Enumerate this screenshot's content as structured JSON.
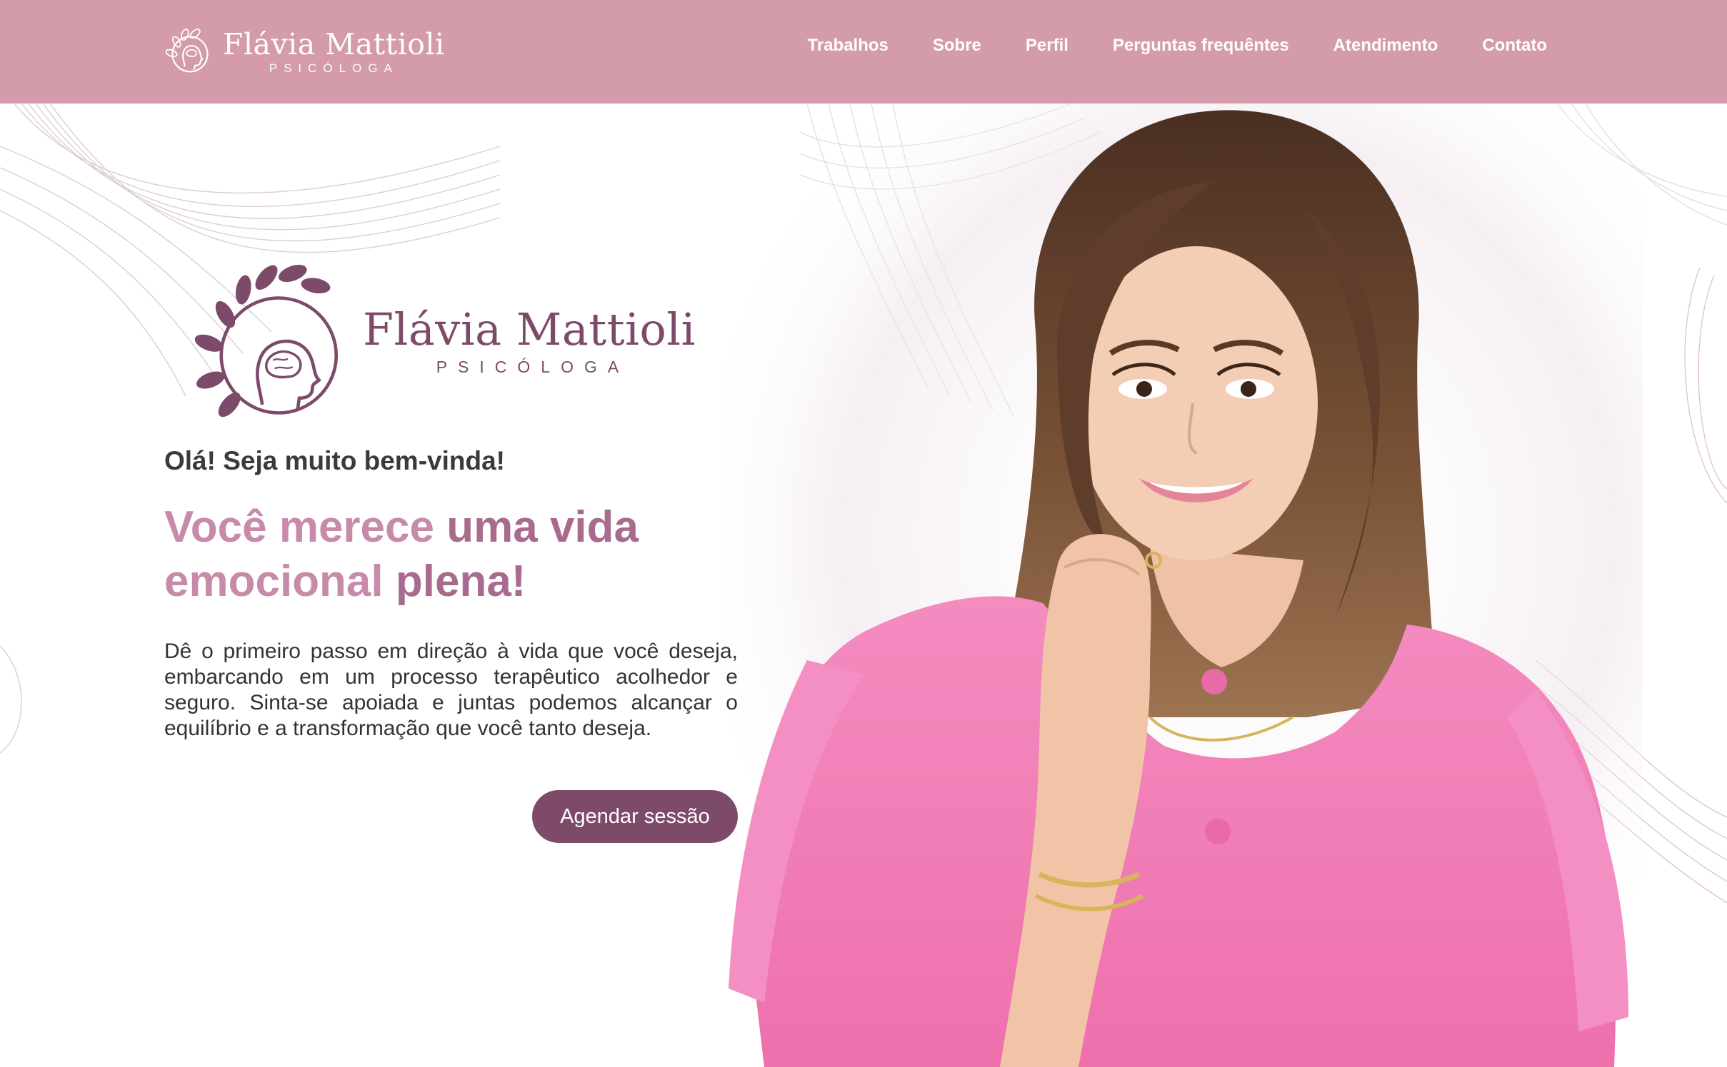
{
  "header": {
    "brand_name": "Flávia Mattioli",
    "brand_sub": "PSICÓLOGA",
    "nav": [
      "Trabalhos",
      "Sobre",
      "Perfil",
      "Perguntas frequêntes",
      "Atendimento",
      "Contato"
    ]
  },
  "hero": {
    "logo_name": "Flávia Mattioli",
    "logo_sub": "PSICÓLOGA",
    "greeting": "Olá! Seja muito bem-vinda!",
    "headline_light_1": "Você merece ",
    "headline_strong_1": "uma vida",
    "headline_light_2": "emocional ",
    "headline_strong_2": "plena!",
    "description": "Dê o primeiro passo em direção à vida que você deseja, embarcando em um processo terapêutico acolhedor e seguro. Sinta-se apoiada e juntas podemos alcançar o equilíbrio e a transformação que você tanto deseja.",
    "cta_label": "Agendar sessão"
  },
  "colors": {
    "header_bg": "#d49bab",
    "brand_purple": "#7d4a6a",
    "headline_pink": "#c88aaa",
    "blouse_pink": "#f07ab0"
  },
  "icons": {
    "brand": "head-with-leaves-logo-icon",
    "hero_logo": "head-with-leaves-logo-icon"
  }
}
